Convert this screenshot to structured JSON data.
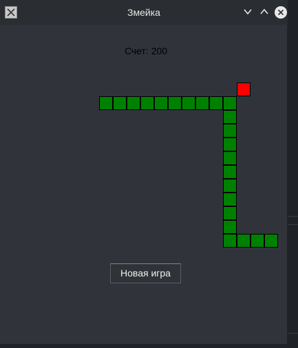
{
  "window": {
    "title": "Змейка"
  },
  "game": {
    "score_label": "Счет: 200",
    "new_game_label": "Новая игра",
    "snake_color": "#008000",
    "food_color": "#ff0000"
  }
}
